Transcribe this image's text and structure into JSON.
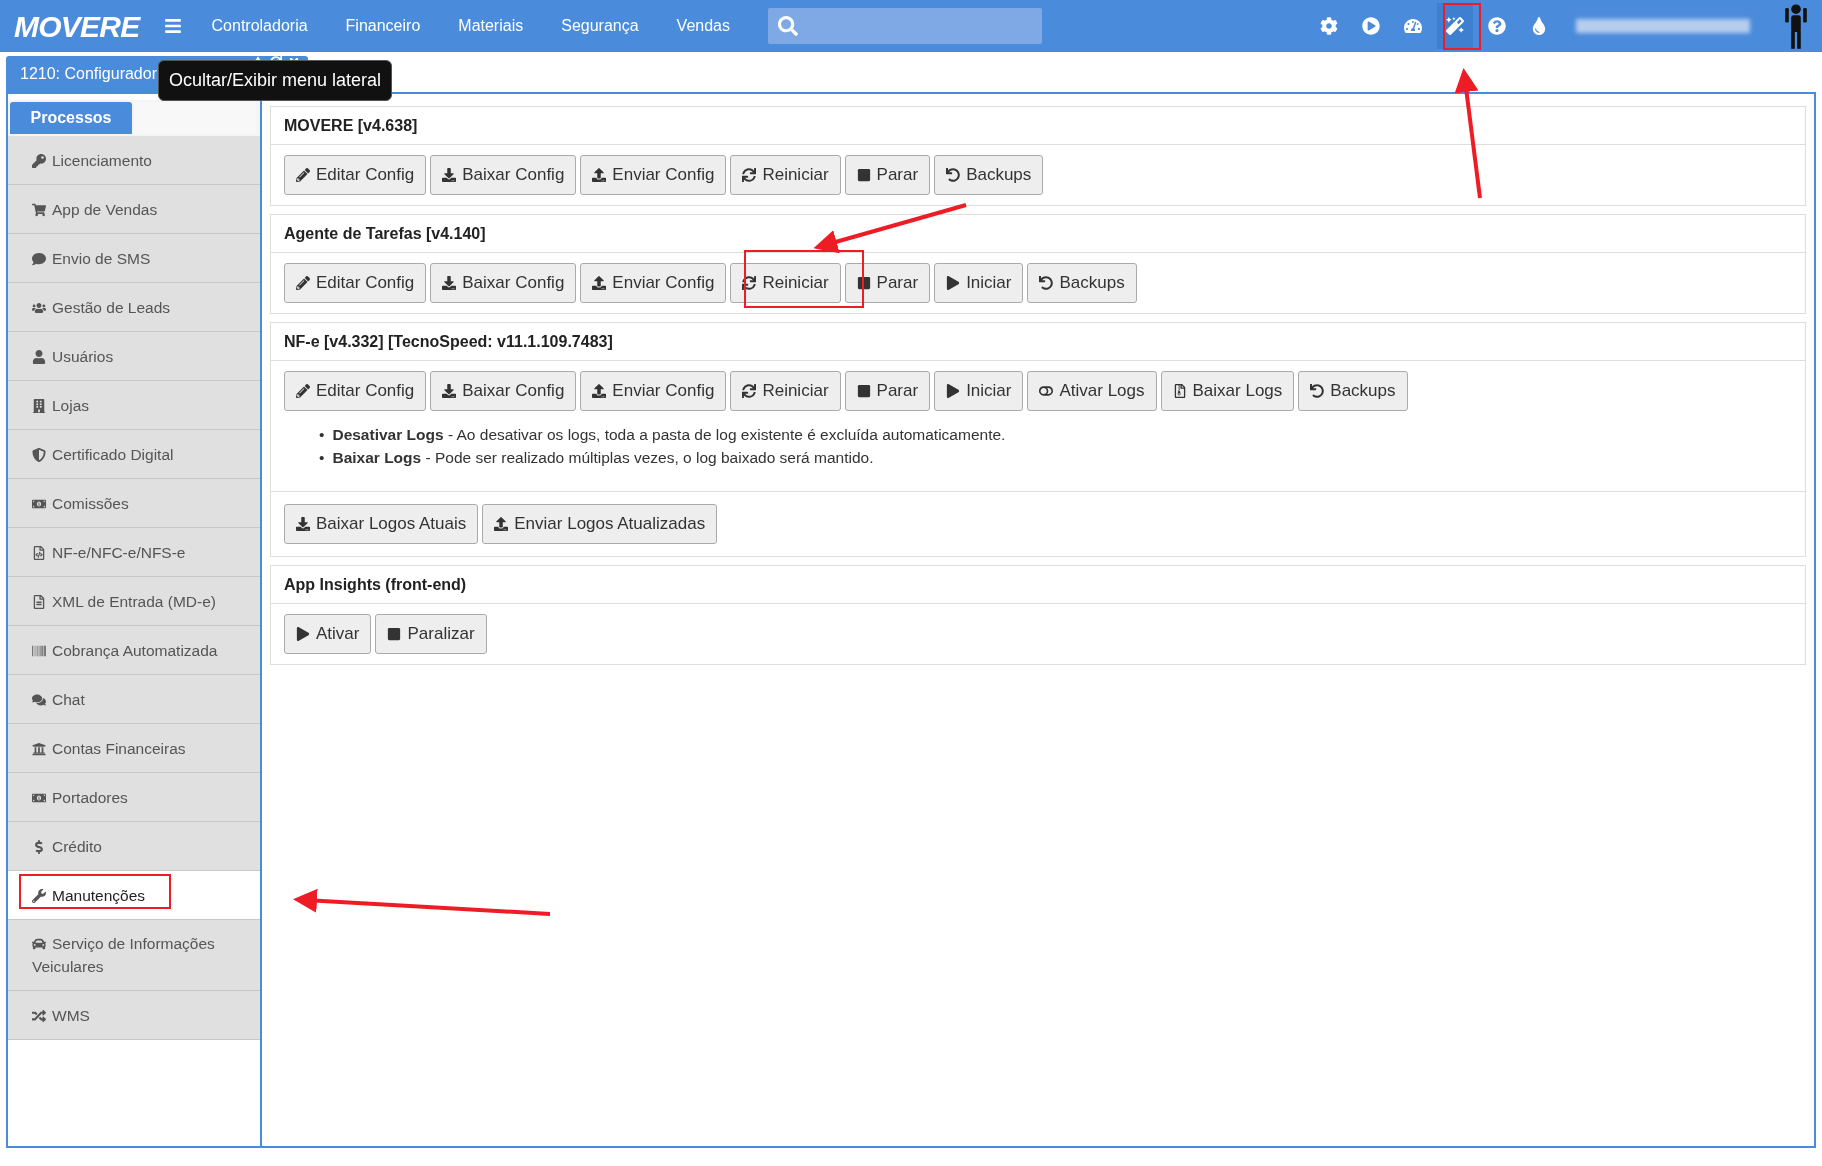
{
  "header": {
    "logo": "MOVERE",
    "menu": [
      "Controladoria",
      "Financeiro",
      "Materiais",
      "Segurança",
      "Vendas"
    ],
    "icons": [
      {
        "kind": "settings",
        "selected": false
      },
      {
        "kind": "play",
        "selected": false
      },
      {
        "kind": "dashboard",
        "selected": false
      },
      {
        "kind": "wand",
        "selected": true
      },
      {
        "kind": "help",
        "selected": false
      },
      {
        "kind": "drop",
        "selected": false
      }
    ]
  },
  "window_tab": {
    "title": "1210: Configurador"
  },
  "tooltip": "Ocultar/Exibir menu lateral",
  "sidebar": {
    "tabs": [
      {
        "label": "Processos",
        "selected": true
      },
      {
        "selected": false
      }
    ],
    "items": [
      {
        "label": "Licenciamento",
        "kind": "key",
        "selected": false
      },
      {
        "label": "App de Vendas",
        "kind": "cart",
        "selected": false
      },
      {
        "label": "Envio de SMS",
        "kind": "comment",
        "selected": false
      },
      {
        "label": "Gestão de Leads",
        "kind": "users",
        "selected": false
      },
      {
        "label": "Usuários",
        "kind": "user",
        "selected": false
      },
      {
        "label": "Lojas",
        "kind": "building",
        "selected": false
      },
      {
        "label": "Certificado Digital",
        "kind": "shield",
        "selected": false
      },
      {
        "label": "Comissões",
        "kind": "money",
        "selected": false
      },
      {
        "label": "NF-e/NFC-e/NFS-e",
        "kind": "filecode",
        "selected": false
      },
      {
        "label": "XML de Entrada (MD-e)",
        "kind": "file",
        "selected": false
      },
      {
        "label": "Cobrança Automatizada",
        "kind": "barcode",
        "selected": false
      },
      {
        "label": "Chat",
        "kind": "chat",
        "selected": false
      },
      {
        "label": "Contas Financeiras",
        "kind": "bank",
        "selected": false
      },
      {
        "label": "Portadores",
        "kind": "money",
        "selected": false
      },
      {
        "label": "Crédito",
        "kind": "dollar",
        "selected": false
      },
      {
        "label": "Manutenções",
        "kind": "wrench",
        "selected": true
      },
      {
        "label": "Serviço de Informações Veiculares",
        "kind": "car",
        "selected": false
      },
      {
        "label": "WMS",
        "kind": "random",
        "selected": false
      }
    ]
  },
  "panels": [
    {
      "title": "MOVERE [v4.638]",
      "buttons": [
        {
          "label": "Editar Config",
          "kind": "edit"
        },
        {
          "label": "Baixar Config",
          "kind": "download"
        },
        {
          "label": "Enviar Config",
          "kind": "upload"
        },
        {
          "label": "Reiniciar",
          "kind": "restart"
        },
        {
          "label": "Parar",
          "kind": "stop"
        },
        {
          "label": "Backups",
          "kind": "undo"
        }
      ]
    },
    {
      "title": "Agente de Tarefas [v4.140]",
      "buttons": [
        {
          "label": "Editar Config",
          "kind": "edit"
        },
        {
          "label": "Baixar Config",
          "kind": "download"
        },
        {
          "label": "Enviar Config",
          "kind": "upload"
        },
        {
          "label": "Reiniciar",
          "kind": "restart"
        },
        {
          "label": "Parar",
          "kind": "stop"
        },
        {
          "label": "Iniciar",
          "kind": "play"
        },
        {
          "label": "Backups",
          "kind": "undo"
        }
      ]
    },
    {
      "title": "NF-e [v4.332] [TecnoSpeed: v11.1.109.7483]",
      "buttons": [
        {
          "label": "Editar Config",
          "kind": "edit"
        },
        {
          "label": "Baixar Config",
          "kind": "download"
        },
        {
          "label": "Enviar Config",
          "kind": "upload"
        },
        {
          "label": "Reiniciar",
          "kind": "restart"
        },
        {
          "label": "Parar",
          "kind": "stop"
        },
        {
          "label": "Iniciar",
          "kind": "play"
        },
        {
          "label": "Ativar Logs",
          "kind": "toggle"
        },
        {
          "label": "Baixar Logs",
          "kind": "archive"
        },
        {
          "label": "Backups",
          "kind": "undo"
        }
      ],
      "notes": [
        {
          "marker": "•",
          "text": "**Desativar Logs** - Ao desativar os logs, toda a pasta de log existente é excluída automaticamente."
        },
        {
          "marker": "•",
          "text": "**Baixar Logs** - Pode ser realizado múltiplas vezes, o log baixado será mantido."
        }
      ],
      "extra_buttons": [
        {
          "label": "Baixar Logos Atuais",
          "kind": "download"
        },
        {
          "label": "Enviar Logos Atualizadas",
          "kind": "upload"
        }
      ]
    },
    {
      "title": "App Insights (front-end)",
      "buttons": [
        {
          "label": "Ativar",
          "kind": "play"
        },
        {
          "label": "Paralizar",
          "kind": "stop"
        }
      ]
    }
  ]
}
